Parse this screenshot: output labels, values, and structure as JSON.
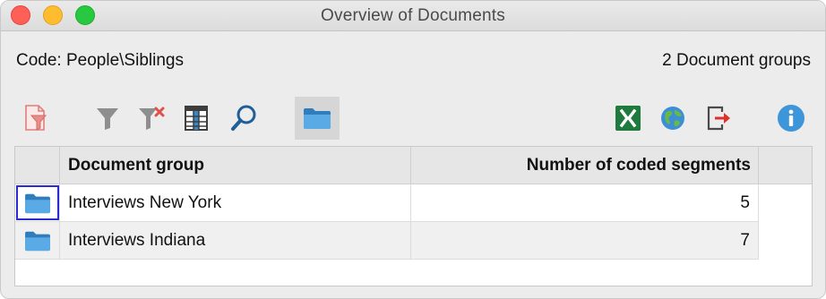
{
  "window": {
    "title": "Overview of Documents"
  },
  "header": {
    "code_label": "Code: People\\Siblings",
    "group_count": "2 Document groups"
  },
  "toolbar": {
    "left_tools": [
      "document-filter-icon",
      "filter-icon",
      "clear-filter-icon",
      "table-columns-icon",
      "search-icon",
      "folder-icon"
    ],
    "right_tools": [
      "excel-export-icon",
      "globe-icon",
      "export-icon",
      "info-icon"
    ],
    "active_tool": "folder-icon"
  },
  "table": {
    "columns": [
      "Document group",
      "Number of coded segments"
    ],
    "rows": [
      {
        "group": "Interviews New York",
        "count": "5"
      },
      {
        "group": "Interviews Indiana",
        "count": "7"
      }
    ]
  },
  "colors": {
    "folder_blue": "#4a9bd6",
    "close": "#fe5f57",
    "minimize": "#febc2e",
    "maximize": "#28c840",
    "focus_outline": "#2b2bd6"
  }
}
